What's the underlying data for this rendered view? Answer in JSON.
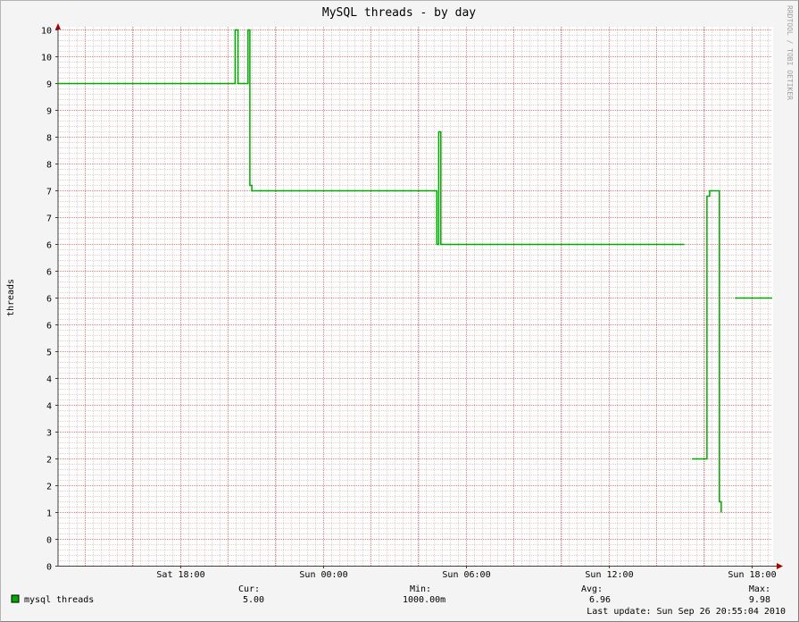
{
  "watermark": "RRDTOOL / TOBI OETIKER",
  "colors": {
    "background": "#f4f4f4",
    "canvas": "#ffffff",
    "series": "#00aa00",
    "minor_grid": "#e0d0d0",
    "major_grid": "#e08080",
    "axis": "#404040",
    "arrow": "#aa0000",
    "text": "#000000"
  },
  "legend": {
    "cur_label": "Cur:",
    "cur_value": "5.00",
    "min_label": "Min:",
    "min_value": "1000.00m",
    "avg_label": "Avg:",
    "avg_value": "6.96",
    "max_label": "Max:",
    "max_value": "9.98",
    "last_update": "Last update: Sun Sep 26 20:55:04 2010"
  },
  "chart_data": {
    "type": "line",
    "title": "MySQL threads - by day",
    "ylabel": "threads",
    "xlabel": "",
    "x_unit": "hours since Sat 12:52",
    "xlim": [
      0,
      30
    ],
    "ylim": [
      0,
      10
    ],
    "y_tick_values": [
      0,
      0.5,
      1,
      1.5,
      2,
      2.5,
      3,
      3.5,
      4,
      4.5,
      5,
      5.5,
      6,
      6.5,
      7,
      7.5,
      8,
      8.5,
      9,
      9.5,
      10
    ],
    "y_tick_labels": [
      "0",
      "0",
      "1",
      "2",
      "2",
      "3",
      "4",
      "4",
      "5",
      "6",
      "6",
      "6",
      "6",
      "7",
      "7",
      "8",
      "8",
      "9",
      "9",
      "10",
      "10"
    ],
    "x_ticks": [
      {
        "x": 5.13,
        "label": "Sat 18:00"
      },
      {
        "x": 11.13,
        "label": "Sun 00:00"
      },
      {
        "x": 17.13,
        "label": "Sun 06:00"
      },
      {
        "x": 23.13,
        "label": "Sun 12:00"
      },
      {
        "x": 29.13,
        "label": "Sun 18:00"
      }
    ],
    "grid": true,
    "legend_position": "bottom-left",
    "series": [
      {
        "name": "mysql threads",
        "segments": [
          [
            [
              0,
              9
            ],
            [
              7.44,
              9
            ],
            [
              7.44,
              10
            ],
            [
              7.56,
              10
            ],
            [
              7.56,
              9
            ],
            [
              7.98,
              9
            ],
            [
              7.98,
              10
            ],
            [
              8.06,
              10
            ],
            [
              8.06,
              7.1
            ],
            [
              8.14,
              7.1
            ],
            [
              8.14,
              7
            ],
            [
              15.91,
              7
            ],
            [
              15.91,
              6
            ],
            [
              15.99,
              6
            ],
            [
              15.99,
              8.1
            ],
            [
              16.08,
              8.1
            ],
            [
              16.08,
              6
            ],
            [
              26.31,
              6
            ]
          ],
          [
            [
              26.63,
              2
            ],
            [
              27.26,
              2
            ],
            [
              27.26,
              6.9
            ],
            [
              27.37,
              6.9
            ],
            [
              27.37,
              7
            ],
            [
              27.78,
              7
            ],
            [
              27.78,
              1.2
            ],
            [
              27.86,
              1.2
            ],
            [
              27.86,
              1
            ]
          ],
          [
            [
              28.44,
              5
            ],
            [
              30,
              5
            ]
          ]
        ]
      }
    ]
  }
}
